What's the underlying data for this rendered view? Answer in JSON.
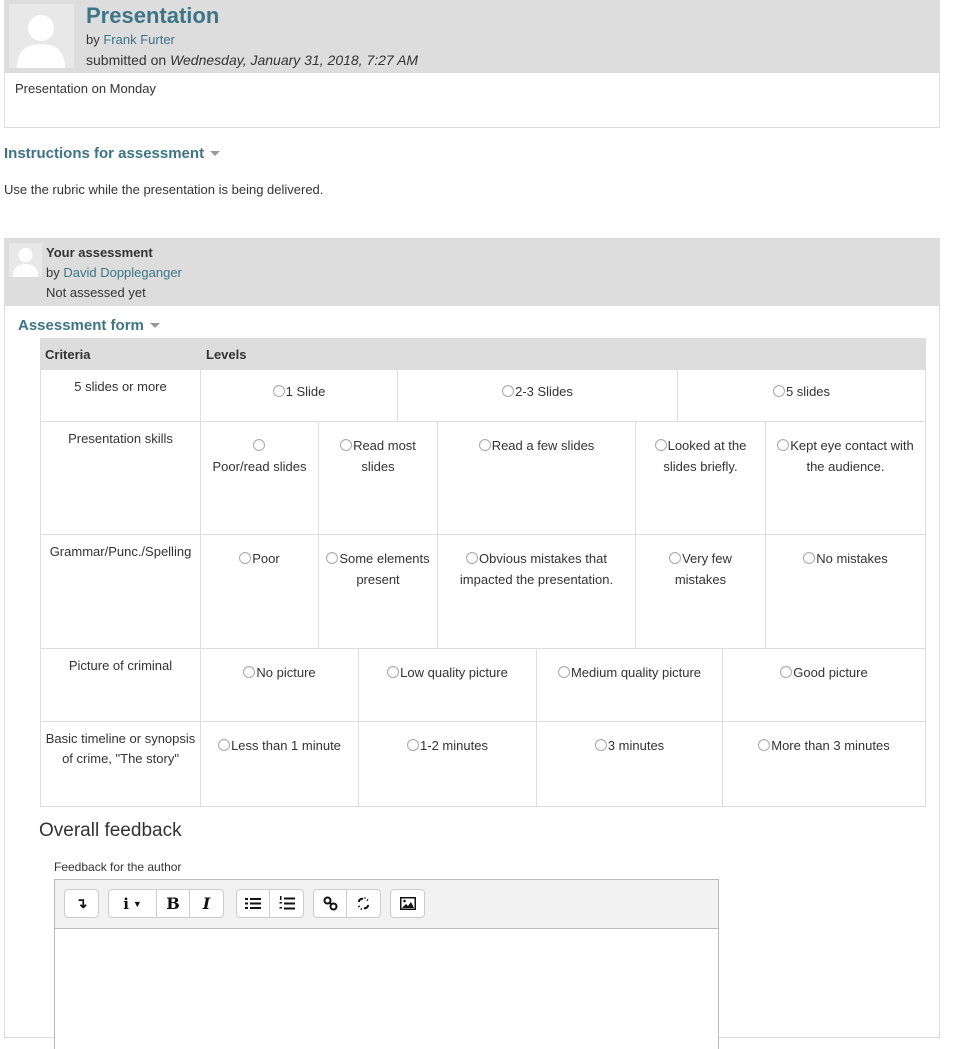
{
  "submission": {
    "title": "Presentation",
    "by_prefix": "by",
    "author": "Frank Furter",
    "submitted_prefix": "submitted on",
    "submitted_date": "Wednesday, January 31, 2018, 7:27 AM",
    "content": "Presentation on Monday"
  },
  "instructions": {
    "title": "Instructions for assessment",
    "text": "Use the rubric while the presentation is being delivered."
  },
  "assessment": {
    "title": "Your assessment",
    "by_prefix": "by",
    "assessor": "David Doppleganger",
    "status": "Not assessed yet",
    "form_title": "Assessment form"
  },
  "rubric": {
    "header_criteria": "Criteria",
    "header_levels": "Levels",
    "rows": [
      {
        "criterion": "5 slides or more",
        "levels": [
          "1 Slide",
          "2-3 Slides",
          "5 slides"
        ]
      },
      {
        "criterion": "Presentation skills",
        "levels": [
          "Poor/read slides",
          "Read most slides",
          "Read a few slides",
          "Looked at the slides briefly.",
          "Kept eye contact with the audience."
        ]
      },
      {
        "criterion": "Grammar/Punc./Spelling",
        "levels": [
          "Poor",
          "Some elements present",
          "Obvious mistakes that impacted the presentation.",
          "Very few mistakes",
          "No mistakes"
        ]
      },
      {
        "criterion": "Picture of criminal",
        "levels": [
          "No picture",
          "Low quality picture",
          "Medium quality picture",
          "Good picture"
        ]
      },
      {
        "criterion": "Basic timeline or synopsis of crime, \"The story\"",
        "levels": [
          "Less than 1 minute",
          "1-2 minutes",
          "3 minutes",
          "More than 3 minutes"
        ]
      }
    ]
  },
  "feedback": {
    "heading": "Overall feedback",
    "label": "Feedback for the author",
    "value": "",
    "toolbar": [
      {
        "name": "toggle-toolbar-icon",
        "glyph": "↴"
      },
      {
        "name": "paragraph-styles-icon",
        "glyph": "i ▾"
      },
      {
        "name": "bold-icon",
        "glyph": "B"
      },
      {
        "name": "italic-icon",
        "glyph": "I"
      },
      {
        "name": "unordered-list-icon",
        "glyph": "☰"
      },
      {
        "name": "ordered-list-icon",
        "glyph": "☷"
      },
      {
        "name": "link-icon",
        "glyph": "⚭"
      },
      {
        "name": "unlink-icon",
        "glyph": "⛓"
      },
      {
        "name": "image-icon",
        "glyph": "▣"
      }
    ]
  }
}
